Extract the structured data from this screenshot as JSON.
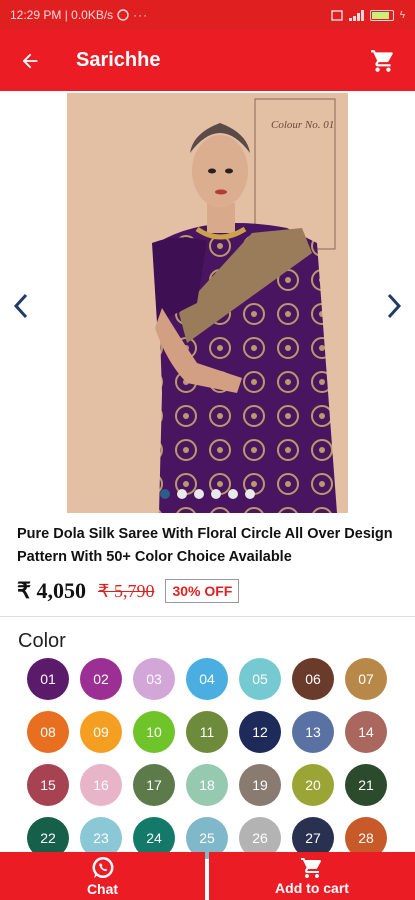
{
  "status_bar": {
    "time_speed": "12:29 PM | 0.0KB/s",
    "battery_level": 0.85
  },
  "app_bar": {
    "title": "Sarichhe",
    "back_icon": "arrow-left-icon",
    "cart_icon": "cart-icon"
  },
  "carousel": {
    "image_caption": "Colour No. 01",
    "slide_count": 6,
    "active_slide": 1
  },
  "product": {
    "title": "Pure Dola Silk Saree With Floral Circle All Over Design Pattern With 50+ Color Choice Available",
    "price": "₹ 4,050",
    "old_price": "₹ 5,790",
    "discount": "30% OFF"
  },
  "colors": {
    "heading": "Color",
    "swatches": [
      {
        "label": "01",
        "color": "#5c1a6b"
      },
      {
        "label": "02",
        "color": "#9c2f94"
      },
      {
        "label": "03",
        "color": "#d3a6d8"
      },
      {
        "label": "04",
        "color": "#4aafe0"
      },
      {
        "label": "05",
        "color": "#75c9d1"
      },
      {
        "label": "06",
        "color": "#6a3a2a"
      },
      {
        "label": "07",
        "color": "#b88848"
      },
      {
        "label": "08",
        "color": "#e86f1f"
      },
      {
        "label": "09",
        "color": "#f49f21"
      },
      {
        "label": "10",
        "color": "#6fc42a"
      },
      {
        "label": "11",
        "color": "#6d8b3b"
      },
      {
        "label": "12",
        "color": "#1e2a5a"
      },
      {
        "label": "13",
        "color": "#5a72a3"
      },
      {
        "label": "14",
        "color": "#a9675e"
      },
      {
        "label": "15",
        "color": "#a64252"
      },
      {
        "label": "16",
        "color": "#e8b4c8"
      },
      {
        "label": "17",
        "color": "#5c7a4a"
      },
      {
        "label": "18",
        "color": "#95c9b0"
      },
      {
        "label": "19",
        "color": "#8a7b70"
      },
      {
        "label": "20",
        "color": "#9ba536"
      },
      {
        "label": "21",
        "color": "#2c4a2c"
      },
      {
        "label": "22",
        "color": "#16604a"
      },
      {
        "label": "23",
        "color": "#89c8d4"
      },
      {
        "label": "24",
        "color": "#137a6a"
      },
      {
        "label": "25",
        "color": "#7fb9c9"
      },
      {
        "label": "26",
        "color": "#b3b3b3"
      },
      {
        "label": "27",
        "color": "#2a3150"
      },
      {
        "label": "28",
        "color": "#c85a2a"
      }
    ]
  },
  "bottom_bar": {
    "chat_label": "Chat",
    "chat_icon": "whatsapp-icon",
    "add_to_cart_label": "Add to cart",
    "add_to_cart_icon": "cart-icon"
  },
  "accent_color": "#ec1c24"
}
